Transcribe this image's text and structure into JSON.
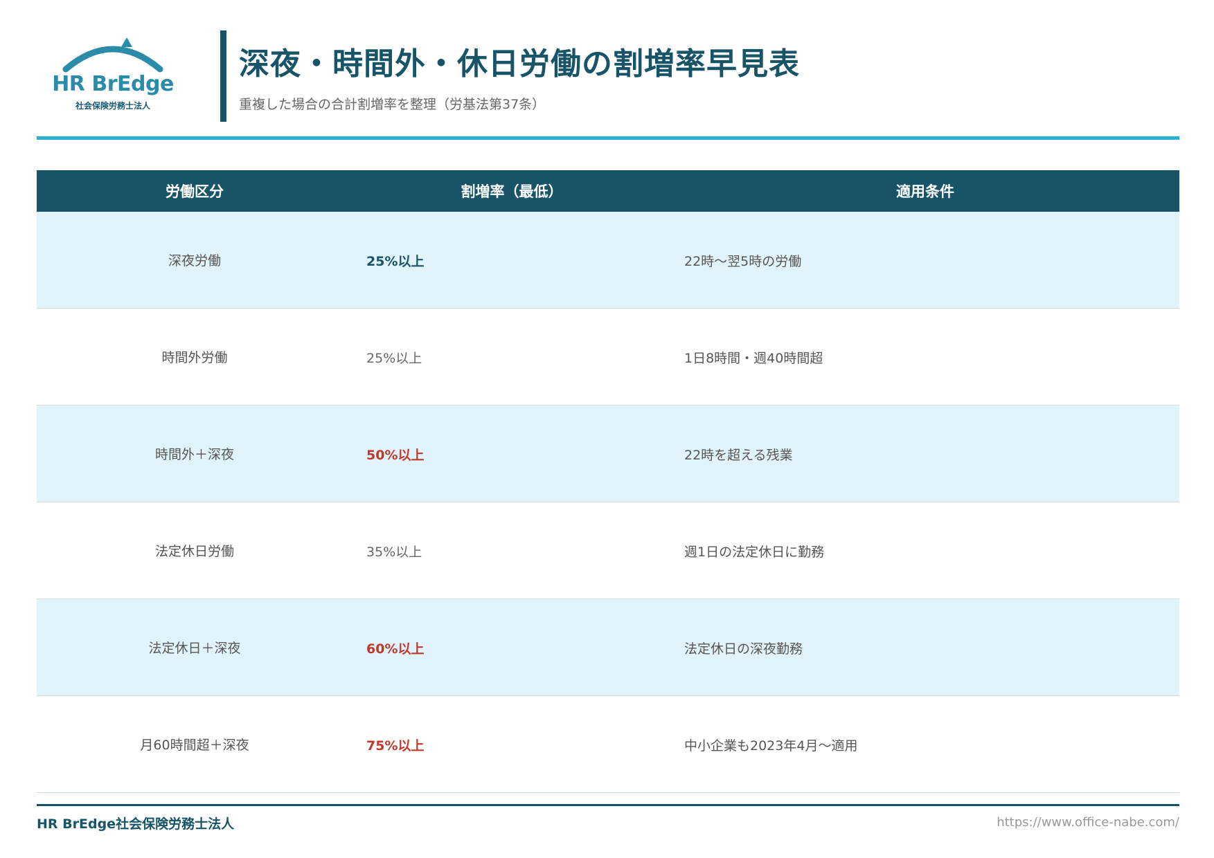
{
  "header": {
    "logo_text": "HR BrEdge",
    "logo_sub": "社会保険労務士法人",
    "title": "深夜・時間外・休日労働の割増率早見表",
    "subtitle": "重複した場合の合計割増率を整理（労基法第37条）"
  },
  "table": {
    "headers": [
      "労働区分",
      "割増率（最低）",
      "適用条件"
    ],
    "rows": [
      {
        "category": "深夜労働",
        "rate": "25%以上",
        "condition": "22時〜翌5時の労働",
        "rate_style": "blue"
      },
      {
        "category": "時間外労働",
        "rate": "25%以上",
        "condition": "1日8時間・週40時間超",
        "rate_style": "normal"
      },
      {
        "category": "時間外＋深夜",
        "rate": "50%以上",
        "condition": "22時を超える残業",
        "rate_style": "red"
      },
      {
        "category": "法定休日労働",
        "rate": "35%以上",
        "condition": "週1日の法定休日に勤務",
        "rate_style": "normal"
      },
      {
        "category": "法定休日＋深夜",
        "rate": "60%以上",
        "condition": "法定休日の深夜勤務",
        "rate_style": "red"
      },
      {
        "category": "月60時間超＋深夜",
        "rate": "75%以上",
        "condition": "中小企業も2023年4月〜適用",
        "rate_style": "red"
      }
    ]
  },
  "footer": {
    "org": "HR BrEdge社会保険労務士法人",
    "url": "https://www.office-nabe.com/"
  },
  "colors": {
    "primary": "#175467",
    "accent": "#2eb0d4",
    "row_alt": "#e2f4fb",
    "highlight_red": "#c0392b"
  }
}
